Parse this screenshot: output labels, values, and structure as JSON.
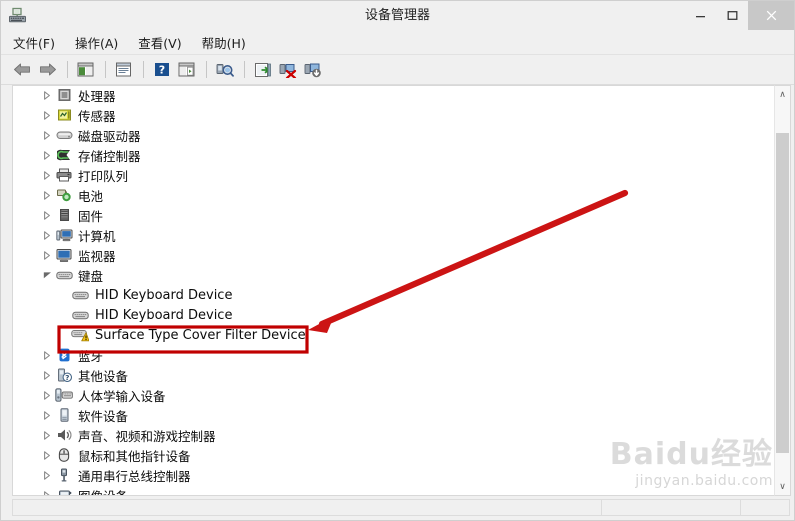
{
  "window": {
    "title": "设备管理器",
    "icon": "device-manager-icon",
    "controls": {
      "minimize": "–",
      "maximize": "☐",
      "close": "×"
    }
  },
  "menubar": {
    "items": [
      {
        "label": "文件(F)",
        "name": "menu-file"
      },
      {
        "label": "操作(A)",
        "name": "menu-action"
      },
      {
        "label": "查看(V)",
        "name": "menu-view"
      },
      {
        "label": "帮助(H)",
        "name": "menu-help"
      }
    ]
  },
  "toolbar": {
    "buttons": [
      {
        "name": "back-button",
        "icon": "back-arrow-icon"
      },
      {
        "name": "forward-button",
        "icon": "forward-arrow-icon"
      },
      {
        "name": "separator-1",
        "icon": "separator"
      },
      {
        "name": "show-hide-console-tree-button",
        "icon": "console-tree-icon"
      },
      {
        "name": "separator-2",
        "icon": "separator"
      },
      {
        "name": "properties-button",
        "icon": "properties-icon"
      },
      {
        "name": "separator-3",
        "icon": "separator"
      },
      {
        "name": "help-button",
        "icon": "help-question-icon"
      },
      {
        "name": "show-hide-action-pane-button",
        "icon": "action-pane-icon"
      },
      {
        "name": "separator-4",
        "icon": "separator"
      },
      {
        "name": "scan-hardware-changes-button",
        "icon": "scan-hardware-icon"
      },
      {
        "name": "separator-5",
        "icon": "separator"
      },
      {
        "name": "update-driver-button",
        "icon": "update-driver-icon"
      },
      {
        "name": "uninstall-device-button",
        "icon": "uninstall-device-icon"
      },
      {
        "name": "disable-device-button",
        "icon": "disable-device-icon"
      }
    ]
  },
  "tree": {
    "items": [
      {
        "label": "处理器",
        "icon": "processor-icon",
        "level": 1,
        "expanded": false,
        "warning": false
      },
      {
        "label": "传感器",
        "icon": "sensor-icon",
        "level": 1,
        "expanded": false,
        "warning": false
      },
      {
        "label": "磁盘驱动器",
        "icon": "disk-drive-icon",
        "level": 1,
        "expanded": false,
        "warning": false
      },
      {
        "label": "存储控制器",
        "icon": "storage-controller-icon",
        "level": 1,
        "expanded": false,
        "warning": false
      },
      {
        "label": "打印队列",
        "icon": "printer-icon",
        "level": 1,
        "expanded": false,
        "warning": false
      },
      {
        "label": "电池",
        "icon": "battery-icon",
        "level": 1,
        "expanded": false,
        "warning": false
      },
      {
        "label": "固件",
        "icon": "firmware-icon",
        "level": 1,
        "expanded": false,
        "warning": false
      },
      {
        "label": "计算机",
        "icon": "computer-icon",
        "level": 1,
        "expanded": false,
        "warning": false
      },
      {
        "label": "监视器",
        "icon": "monitor-icon",
        "level": 1,
        "expanded": false,
        "warning": false
      },
      {
        "label": "键盘",
        "icon": "keyboard-icon",
        "level": 1,
        "expanded": true,
        "warning": false
      },
      {
        "label": "HID Keyboard Device",
        "icon": "keyboard-icon",
        "level": 2,
        "expanded": null,
        "warning": false,
        "latin": true
      },
      {
        "label": "HID Keyboard Device",
        "icon": "keyboard-icon",
        "level": 2,
        "expanded": null,
        "warning": false,
        "latin": true
      },
      {
        "label": "Surface Type Cover Filter Device",
        "icon": "keyboard-warning-icon",
        "level": 2,
        "expanded": null,
        "warning": true,
        "latin": true,
        "highlighted": true
      },
      {
        "label": "蓝牙",
        "icon": "bluetooth-icon",
        "level": 1,
        "expanded": false,
        "warning": false
      },
      {
        "label": "其他设备",
        "icon": "other-device-icon",
        "level": 1,
        "expanded": false,
        "warning": false
      },
      {
        "label": "人体学输入设备",
        "icon": "hid-input-icon",
        "level": 1,
        "expanded": false,
        "warning": false
      },
      {
        "label": "软件设备",
        "icon": "software-device-icon",
        "level": 1,
        "expanded": false,
        "warning": false
      },
      {
        "label": "声音、视频和游戏控制器",
        "icon": "sound-video-game-icon",
        "level": 1,
        "expanded": false,
        "warning": false
      },
      {
        "label": "鼠标和其他指针设备",
        "icon": "mouse-icon",
        "level": 1,
        "expanded": false,
        "warning": false
      },
      {
        "label": "通用串行总线控制器",
        "icon": "usb-controller-icon",
        "level": 1,
        "expanded": false,
        "warning": false
      },
      {
        "label": "图像设备",
        "icon": "imaging-device-icon",
        "level": 1,
        "expanded": false,
        "warning": false
      }
    ]
  },
  "scrollbar": {
    "up_arrow": "∧",
    "down_arrow": "∨"
  },
  "annotation": {
    "color": "#c00000",
    "box_target": "Surface Type Cover Filter Device",
    "arrow": "red-pointer-arrow"
  },
  "watermark": {
    "logo": "Baidu经验",
    "url": "jingyan.baidu.com"
  }
}
